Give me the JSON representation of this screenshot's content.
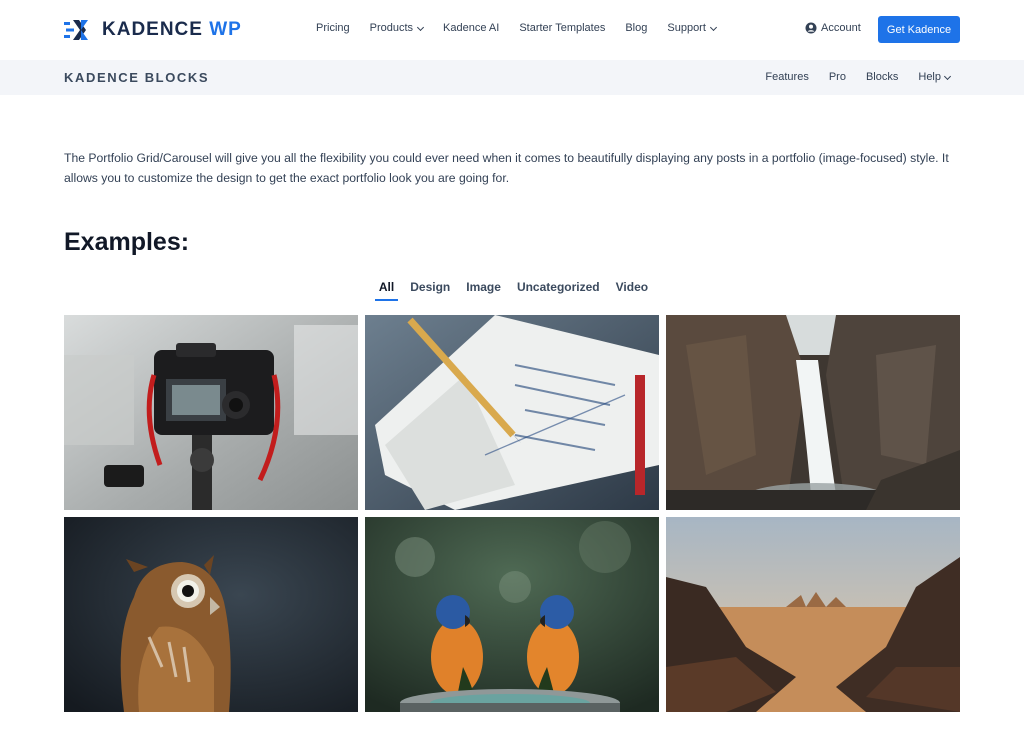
{
  "header": {
    "logo": {
      "brand": "KADENCE",
      "brand_accent": "WP"
    },
    "nav": [
      {
        "label": "Pricing",
        "has_dropdown": false
      },
      {
        "label": "Products",
        "has_dropdown": true
      },
      {
        "label": "Kadence AI",
        "has_dropdown": false
      },
      {
        "label": "Starter Templates",
        "has_dropdown": false
      },
      {
        "label": "Blog",
        "has_dropdown": false
      },
      {
        "label": "Support",
        "has_dropdown": true
      }
    ],
    "account_label": "Account",
    "cta_label": "Get Kadence"
  },
  "subheader": {
    "title": "KADENCE BLOCKS",
    "nav": [
      {
        "label": "Features",
        "has_dropdown": false
      },
      {
        "label": "Pro",
        "has_dropdown": false
      },
      {
        "label": "Blocks",
        "has_dropdown": false
      },
      {
        "label": "Help",
        "has_dropdown": true
      }
    ]
  },
  "main": {
    "intro": "The Portfolio Grid/Carousel will give you all the flexibility you could ever need when it comes to beautifully displaying any posts in a portfolio (image-focused) style. It allows you to customize the design to get the exact portfolio look you are going for.",
    "heading": "Examples:",
    "filters": [
      {
        "label": "All",
        "active": true
      },
      {
        "label": "Design",
        "active": false
      },
      {
        "label": "Image",
        "active": false
      },
      {
        "label": "Uncategorized",
        "active": false
      },
      {
        "label": "Video",
        "active": false
      }
    ],
    "portfolio_items": [
      {
        "image": "camera-on-tripod"
      },
      {
        "image": "notebook-with-pencil"
      },
      {
        "image": "waterfall-canyon"
      },
      {
        "image": "owl-portrait"
      },
      {
        "image": "two-parrots"
      },
      {
        "image": "desert-valley"
      }
    ]
  },
  "colors": {
    "accent": "#1e73e8",
    "brand_dark": "#1a2b4c",
    "subheader_bg": "#f3f5f9",
    "text": "#334155"
  }
}
